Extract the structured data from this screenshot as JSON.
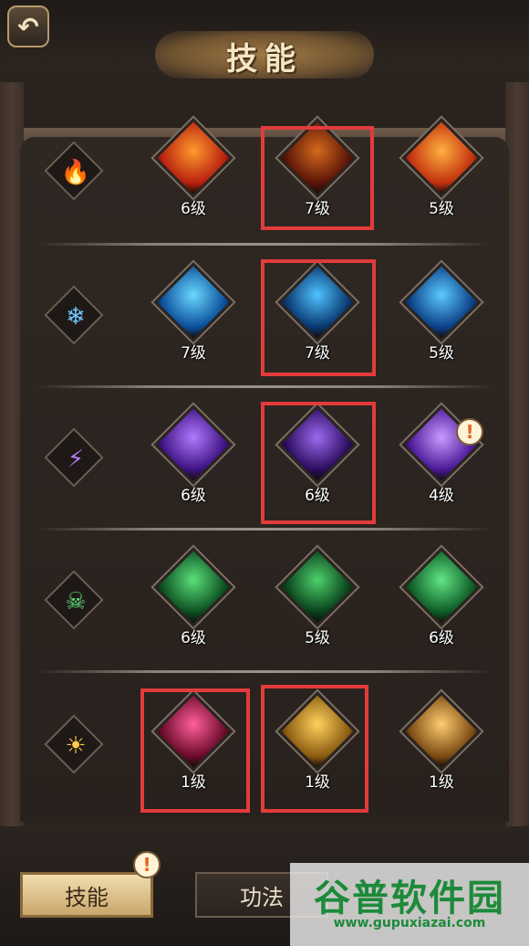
{
  "header": {
    "title": "技能",
    "back_glyph": "↶"
  },
  "rows": [
    {
      "element": "fire",
      "element_glyph": "🔥",
      "skills": [
        {
          "level": "6级",
          "colors": [
            "#ff9a2e",
            "#b8200e"
          ]
        },
        {
          "level": "7级",
          "colors": [
            "#d46a1c",
            "#5a1408"
          ]
        },
        {
          "level": "5级",
          "colors": [
            "#ffb040",
            "#c2300e"
          ]
        }
      ]
    },
    {
      "element": "ice",
      "element_glyph": "❄",
      "skills": [
        {
          "level": "7级",
          "colors": [
            "#6ad8ff",
            "#0a4e9a"
          ]
        },
        {
          "level": "7级",
          "colors": [
            "#4fc2ff",
            "#08366e"
          ]
        },
        {
          "level": "5级",
          "colors": [
            "#5ac9ff",
            "#0b3f86"
          ]
        }
      ]
    },
    {
      "element": "lightning",
      "element_glyph": "⚡",
      "skills": [
        {
          "level": "6级",
          "colors": [
            "#b07aff",
            "#3e1282"
          ]
        },
        {
          "level": "6级",
          "colors": [
            "#9d6af0",
            "#2a0c5c"
          ]
        },
        {
          "level": "4级",
          "colors": [
            "#c89cff",
            "#4a1896"
          ]
        }
      ]
    },
    {
      "element": "poison",
      "element_glyph": "☠",
      "skills": [
        {
          "level": "6级",
          "colors": [
            "#5ce07a",
            "#0b4f20"
          ]
        },
        {
          "level": "5级",
          "colors": [
            "#4fd06c",
            "#08401a"
          ]
        },
        {
          "level": "6级",
          "colors": [
            "#62e686",
            "#0d5a24"
          ]
        }
      ]
    },
    {
      "element": "sun",
      "element_glyph": "☀",
      "skills": [
        {
          "level": "1级",
          "colors": [
            "#ff5f9a",
            "#6a0a2a"
          ]
        },
        {
          "level": "1级",
          "colors": [
            "#ffd25e",
            "#8a5a10"
          ]
        },
        {
          "level": "1级",
          "colors": [
            "#ffcc70",
            "#7a4a12"
          ]
        }
      ]
    }
  ],
  "tabs": {
    "skill_label": "技能",
    "art_label": "功法"
  },
  "alert_glyph": "!",
  "watermark": {
    "name": "谷普软件园",
    "url": "www.gupuxiazai.com"
  },
  "colors": {
    "highlight": "#e33b3b",
    "background": "#2a221d"
  }
}
